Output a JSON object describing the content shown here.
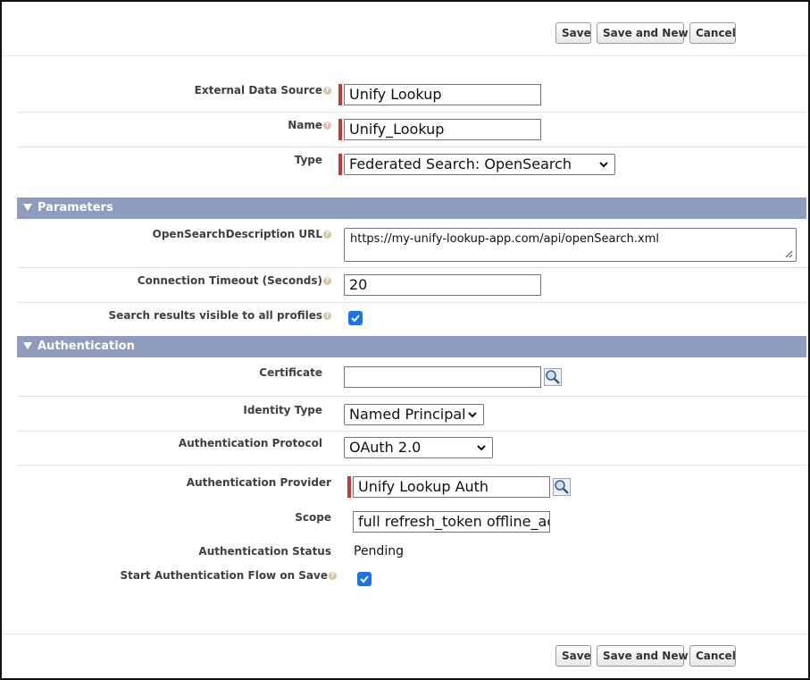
{
  "toolbar": {
    "save_label": "Save",
    "save_new_label": "Save and New",
    "cancel_label": "Cancel"
  },
  "fields": {
    "external_data_source": {
      "label": "External Data Source",
      "value": "Unify Lookup"
    },
    "name": {
      "label": "Name",
      "value": "Unify_Lookup"
    },
    "type": {
      "label": "Type",
      "value": "Federated Search: OpenSearch"
    }
  },
  "parameters": {
    "title": "Parameters",
    "osd_url": {
      "label": "OpenSearchDescription URL",
      "value": "https://my-unify-lookup-app.com/api/openSearch.xml"
    },
    "timeout": {
      "label": "Connection Timeout (Seconds)",
      "value": "20"
    },
    "visible_all": {
      "label": "Search results visible to all profiles",
      "checked": true
    }
  },
  "authentication": {
    "title": "Authentication",
    "certificate": {
      "label": "Certificate",
      "value": ""
    },
    "identity_type": {
      "label": "Identity Type",
      "value": "Named Principal"
    },
    "protocol": {
      "label": "Authentication Protocol",
      "value": "OAuth 2.0"
    },
    "provider": {
      "label": "Authentication Provider",
      "value": "Unify Lookup Auth"
    },
    "scope": {
      "label": "Scope",
      "value": "full refresh_token offline_acc"
    },
    "status": {
      "label": "Authentication Status",
      "value": "Pending"
    },
    "start_flow": {
      "label": "Start Authentication Flow on Save",
      "checked": true
    }
  },
  "colors": {
    "section_header": "#8e9dbe",
    "required_bar": "#c23934",
    "checkbox": "#1a73e8"
  },
  "icons": {
    "help": "help-icon",
    "lookup": "lookup-icon",
    "dropdown": "chevron-down-icon"
  }
}
